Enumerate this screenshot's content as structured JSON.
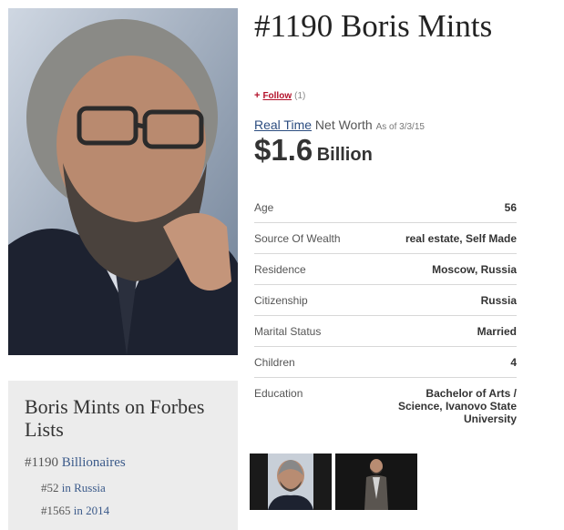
{
  "profile": {
    "title": "#1190 Boris Mints",
    "follow_label": "Follow",
    "follow_count": "(1)",
    "realtime_label": "Real Time",
    "networth_label": "Net Worth",
    "asof_label": "As of 3/3/15",
    "worth_amount": "$1.6",
    "worth_unit": "Billion"
  },
  "stats": [
    {
      "label": "Age",
      "value": "56"
    },
    {
      "label": "Source Of Wealth",
      "value": "real estate, Self Made"
    },
    {
      "label": "Residence",
      "value": "Moscow, Russia"
    },
    {
      "label": "Citizenship",
      "value": "Russia"
    },
    {
      "label": "Marital Status",
      "value": "Married"
    },
    {
      "label": "Children",
      "value": "4"
    },
    {
      "label": "Education",
      "value": "Bachelor of Arts / Science, Ivanovo State University"
    }
  ],
  "lists": {
    "title": "Boris Mints on Forbes Lists",
    "main_rank": "#1190",
    "main_name": "Billionaires",
    "sub1_rank": "#52",
    "sub1_link": "in Russia",
    "sub2_rank": "#1565",
    "sub2_link": "in 2014"
  },
  "colors": {
    "accent_red": "#b3122b",
    "link_blue": "#2c4d80",
    "lists_bg": "#ececec"
  }
}
